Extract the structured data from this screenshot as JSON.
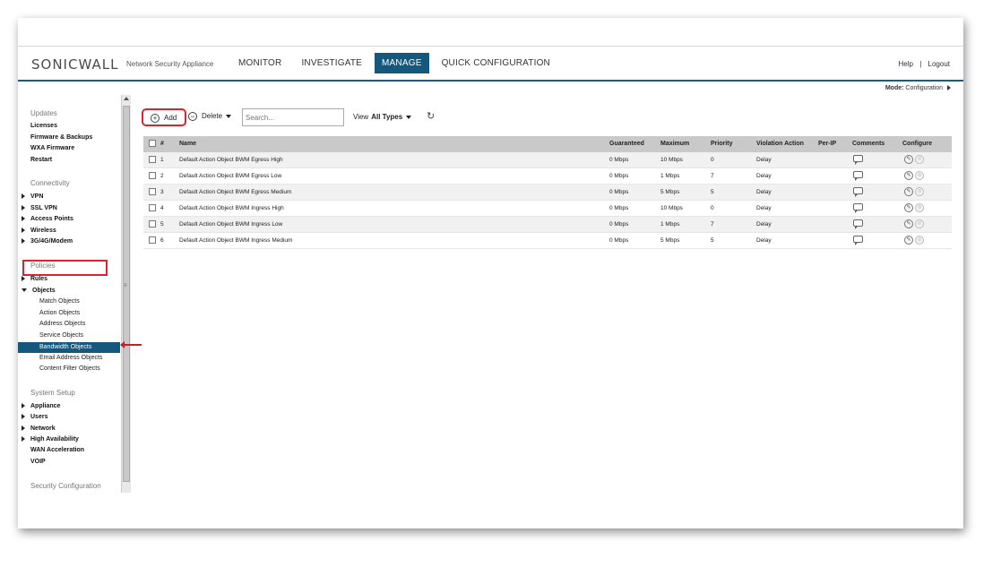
{
  "header": {
    "logo": "SONICWALL",
    "appliance": "Network Security Appliance",
    "nav": [
      "MONITOR",
      "INVESTIGATE",
      "MANAGE",
      "QUICK CONFIGURATION"
    ],
    "active_nav": "MANAGE",
    "help": "Help",
    "separator": "|",
    "logout": "Logout"
  },
  "mode": {
    "label": "Mode:",
    "value": "Configuration"
  },
  "sidebar": {
    "updates": {
      "title": "Updates",
      "items": [
        "Licenses",
        "Firmware & Backups",
        "WXA Firmware",
        "Restart"
      ]
    },
    "connectivity": {
      "title": "Connectivity",
      "items": [
        "VPN",
        "SSL VPN",
        "Access Points",
        "Wireless",
        "3G/4G/Modem"
      ]
    },
    "policies": {
      "title": "Policies",
      "rules": "Rules",
      "objects": "Objects",
      "subitems": [
        "Match Objects",
        "Action Objects",
        "Address Objects",
        "Service Objects",
        "Bandwidth Objects",
        "Email Address Objects",
        "Content Filter Objects"
      ],
      "selected": "Bandwidth Objects"
    },
    "system_setup": {
      "title": "System Setup",
      "items": [
        "Appliance",
        "Users",
        "Network",
        "High Availability",
        "WAN Acceleration",
        "VOIP"
      ]
    },
    "security_configuration": {
      "title": "Security Configuration"
    }
  },
  "toolbar": {
    "add": "Add",
    "delete": "Delete",
    "search_placeholder": "Search...",
    "view_label": "View",
    "view_value": "All Types"
  },
  "table": {
    "columns": [
      "#",
      "Name",
      "Guaranteed",
      "Maximum",
      "Priority",
      "Violation Action",
      "Per-IP",
      "Comments",
      "Configure"
    ],
    "rows": [
      {
        "num": "1",
        "name": "Default Action Object BWM Egress High",
        "guaranteed": "0 Mbps",
        "maximum": "10 Mbps",
        "priority": "0",
        "violation": "Delay"
      },
      {
        "num": "2",
        "name": "Default Action Object BWM Egress Low",
        "guaranteed": "0 Mbps",
        "maximum": "1 Mbps",
        "priority": "7",
        "violation": "Delay"
      },
      {
        "num": "3",
        "name": "Default Action Object BWM Egress Medium",
        "guaranteed": "0 Mbps",
        "maximum": "5 Mbps",
        "priority": "5",
        "violation": "Delay"
      },
      {
        "num": "4",
        "name": "Default Action Object BWM Ingress High",
        "guaranteed": "0 Mbps",
        "maximum": "10 Mbps",
        "priority": "0",
        "violation": "Delay"
      },
      {
        "num": "5",
        "name": "Default Action Object BWM Ingress Low",
        "guaranteed": "0 Mbps",
        "maximum": "1 Mbps",
        "priority": "7",
        "violation": "Delay"
      },
      {
        "num": "6",
        "name": "Default Action Object BWM Ingress Medium",
        "guaranteed": "0 Mbps",
        "maximum": "5 Mbps",
        "priority": "5",
        "violation": "Delay"
      }
    ]
  },
  "colors": {
    "accent": "#14587e",
    "highlight_box": "#d9232f"
  }
}
